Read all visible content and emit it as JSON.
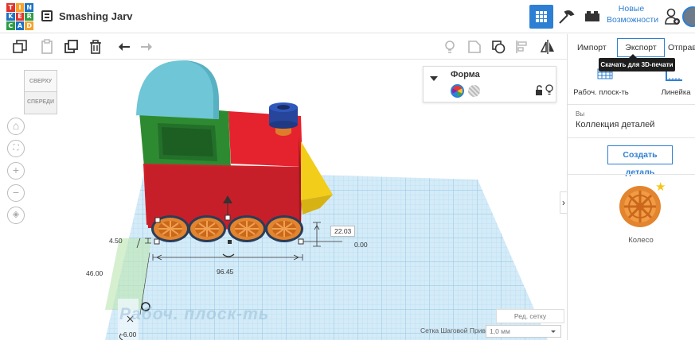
{
  "app": {
    "logo_letters": [
      "T",
      "I",
      "N",
      "K",
      "E",
      "R",
      "C",
      "A",
      "D"
    ],
    "document_title": "Smashing Jarv",
    "new_features": "Новые Возможности",
    "new_features_line1": "Новые",
    "new_features_line2": "Возможности"
  },
  "toolbar": {
    "icons": [
      "copy-icon",
      "paste-icon",
      "duplicate-icon",
      "delete-icon",
      "undo-icon",
      "redo-icon",
      "bulb-icon",
      "group-icon",
      "ungroup-icon",
      "align-icon",
      "mirror-icon"
    ]
  },
  "right_panel": {
    "import_label": "Импорт",
    "export_label": "Экспорт",
    "send_label": "Отправи",
    "export_tooltip": "Скачать для 3D-печати",
    "workplane_label": "Рабоч. плоск-ть",
    "ruler_label": "Линейка",
    "collection_owner": "Вы",
    "collection_name": "Коллекция деталей",
    "create_part_label": "Создать деталь",
    "part_name": "Колесо"
  },
  "shape_panel": {
    "title": "Форма"
  },
  "viewcube": {
    "top_label": "СВЕРХУ",
    "front_label": "СПЕРЕДИ"
  },
  "dimensions": {
    "height_offset": "4.50",
    "height": "22.03",
    "elevation": "0.00",
    "length": "96.45",
    "depth": "46.00",
    "origin_offset": "-6.00"
  },
  "canvas": {
    "workplane_watermark": "Рабоч. плоск-ть",
    "edit_grid_label": "Ред. сетку",
    "snap_label": "Сетка Шаговой Привязки",
    "snap_value": "1,0 мм"
  },
  "colors": {
    "accent": "#2d7fd3",
    "workplane": "#cfe6f5",
    "grid_line": "#9fcde8"
  }
}
